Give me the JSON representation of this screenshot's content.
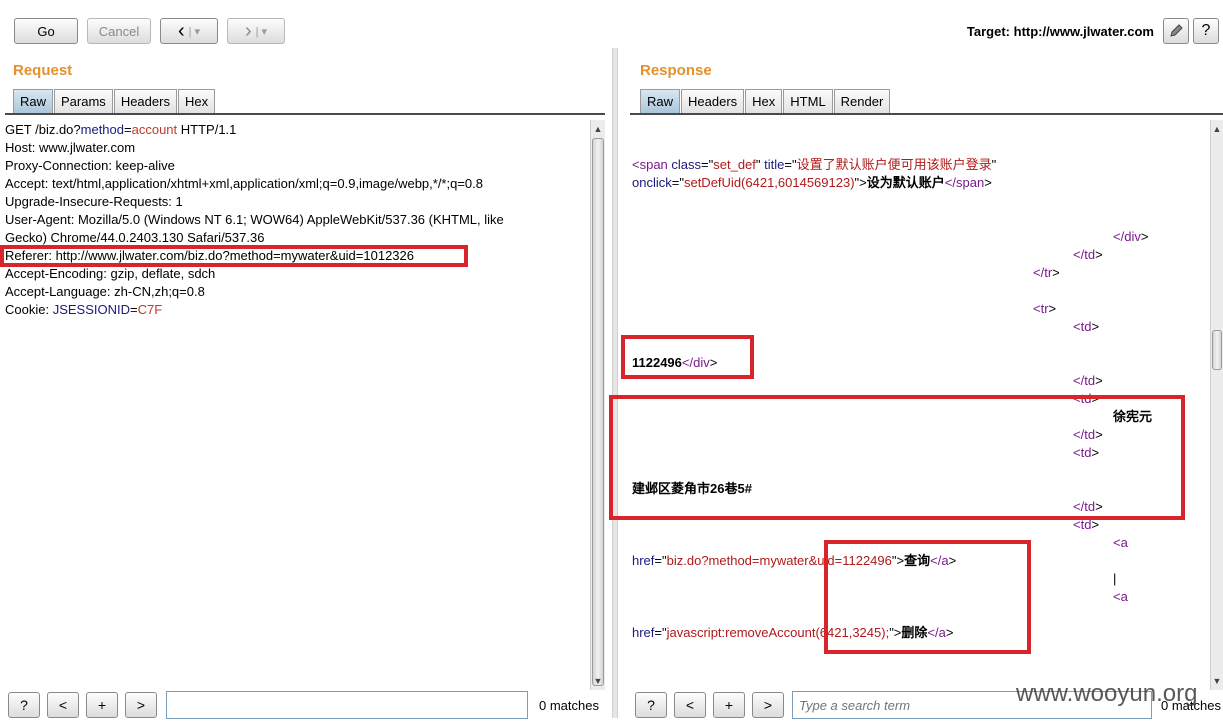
{
  "toolbar": {
    "go_label": "Go",
    "cancel_label": "Cancel",
    "back_icon": "chevron-left-icon",
    "forward_icon": "chevron-right-icon",
    "dropdown_glyph": "▾",
    "target_label": "Target: http://www.jlwater.com",
    "edit_icon": "pencil-icon",
    "help_label": "?"
  },
  "request": {
    "title": "Request",
    "tabs": [
      "Raw",
      "Params",
      "Headers",
      "Hex"
    ],
    "active_tab": "Raw",
    "lines": [
      {
        "parts": [
          {
            "t": "GET /biz.do?",
            "c": ""
          },
          {
            "t": "method",
            "c": "at"
          },
          {
            "t": "=",
            "c": ""
          },
          {
            "t": "account",
            "c": "kw"
          },
          {
            "t": " HTTP/1.1",
            "c": ""
          }
        ]
      },
      {
        "parts": [
          {
            "t": "Host: www.jlwater.com",
            "c": ""
          }
        ]
      },
      {
        "parts": [
          {
            "t": "Proxy-Connection: keep-alive",
            "c": ""
          }
        ]
      },
      {
        "parts": [
          {
            "t": "Accept: text/html,application/xhtml+xml,application/xml;q=0.9,image/webp,*/*;q=0.8",
            "c": ""
          }
        ]
      },
      {
        "parts": [
          {
            "t": "Upgrade-Insecure-Requests: 1",
            "c": ""
          }
        ]
      },
      {
        "parts": [
          {
            "t": "User-Agent: Mozilla/5.0 (Windows NT 6.1; WOW64) AppleWebKit/537.36 (KHTML, like",
            "c": ""
          }
        ]
      },
      {
        "parts": [
          {
            "t": "Gecko) Chrome/44.0.2403.130 Safari/537.36",
            "c": ""
          }
        ]
      },
      {
        "parts": [
          {
            "t": "Referer: http://www.jlwater.com/biz.do?method=mywater&uid=1012326",
            "c": ""
          }
        ]
      },
      {
        "parts": [
          {
            "t": "Accept-Encoding: gzip, deflate, sdch",
            "c": ""
          }
        ]
      },
      {
        "parts": [
          {
            "t": "Accept-Language: zh-CN,zh;q=0.8",
            "c": ""
          }
        ]
      },
      {
        "parts": [
          {
            "t": "Cookie: ",
            "c": ""
          },
          {
            "t": "JSESSIONID",
            "c": "at"
          },
          {
            "t": "=",
            "c": ""
          },
          {
            "t": "C7F",
            "c": "kw"
          }
        ]
      }
    ],
    "search_value": "",
    "matches": "0 matches",
    "help_label": "?",
    "prev_label": "<",
    "add_label": "+",
    "next_label": ">"
  },
  "response": {
    "title": "Response",
    "tabs": [
      "Raw",
      "Headers",
      "Hex",
      "HTML",
      "Render"
    ],
    "active_tab": "Raw",
    "lines": [
      {
        "parts": [
          {
            "t": "<",
            "c": "tg"
          },
          {
            "t": "span",
            "c": "tg"
          },
          {
            "t": " class",
            "c": "at"
          },
          {
            "t": "=\"",
            "c": ""
          },
          {
            "t": "set_def",
            "c": "av"
          },
          {
            "t": "\" ",
            "c": ""
          },
          {
            "t": "title",
            "c": "at"
          },
          {
            "t": "=\"",
            "c": ""
          },
          {
            "t": "设置了默认账户便可用该账户登录",
            "c": "av"
          },
          {
            "t": "\"",
            "c": ""
          }
        ]
      },
      {
        "parts": [
          {
            "t": "onclick",
            "c": "at"
          },
          {
            "t": "=\"",
            "c": ""
          },
          {
            "t": "setDefUid(6421,6014569123)",
            "c": "av"
          },
          {
            "t": "\">",
            "c": ""
          },
          {
            "t": "设为默认账户",
            "c": "bold"
          },
          {
            "t": "</",
            "c": "tg"
          },
          {
            "t": "span",
            "c": "tg"
          },
          {
            "t": ">",
            "c": ""
          }
        ]
      },
      {
        "parts": [
          {
            "t": "</",
            "c": "tg"
          },
          {
            "t": "div",
            "c": "tg"
          },
          {
            "t": ">",
            "c": ""
          }
        ]
      },
      {
        "parts": [
          {
            "t": "</",
            "c": "tg"
          },
          {
            "t": "td",
            "c": "tg"
          },
          {
            "t": ">",
            "c": ""
          }
        ]
      },
      {
        "parts": [
          {
            "t": "</",
            "c": "tg"
          },
          {
            "t": "tr",
            "c": "tg"
          },
          {
            "t": ">",
            "c": ""
          }
        ]
      },
      {
        "parts": [
          {
            "t": "<",
            "c": "tg"
          },
          {
            "t": "tr",
            "c": "tg"
          },
          {
            "t": ">",
            "c": ""
          }
        ]
      },
      {
        "parts": [
          {
            "t": "<",
            "c": "tg"
          },
          {
            "t": "td",
            "c": "tg"
          },
          {
            "t": ">",
            "c": ""
          }
        ]
      },
      {
        "parts": [
          {
            "t": "1122496",
            "c": "bold"
          },
          {
            "t": "</",
            "c": "tg"
          },
          {
            "t": "div",
            "c": "tg"
          },
          {
            "t": ">",
            "c": ""
          }
        ]
      },
      {
        "parts": [
          {
            "t": "</",
            "c": "tg"
          },
          {
            "t": "td",
            "c": "tg"
          },
          {
            "t": ">",
            "c": ""
          }
        ]
      },
      {
        "parts": [
          {
            "t": "<",
            "c": "tg"
          },
          {
            "t": "td",
            "c": "tg"
          },
          {
            "t": ">",
            "c": ""
          }
        ]
      },
      {
        "parts": [
          {
            "t": "徐宪元",
            "c": "bold"
          }
        ]
      },
      {
        "parts": [
          {
            "t": "</",
            "c": "tg"
          },
          {
            "t": "td",
            "c": "tg"
          },
          {
            "t": ">",
            "c": ""
          }
        ]
      },
      {
        "parts": [
          {
            "t": "<",
            "c": "tg"
          },
          {
            "t": "td",
            "c": "tg"
          },
          {
            "t": ">",
            "c": ""
          }
        ]
      },
      {
        "parts": [
          {
            "t": "建邺区菱角市26巷5#",
            "c": "bold"
          }
        ]
      },
      {
        "parts": [
          {
            "t": "</",
            "c": "tg"
          },
          {
            "t": "td",
            "c": "tg"
          },
          {
            "t": ">",
            "c": ""
          }
        ]
      },
      {
        "parts": [
          {
            "t": "<",
            "c": "tg"
          },
          {
            "t": "td",
            "c": "tg"
          },
          {
            "t": ">",
            "c": ""
          }
        ]
      },
      {
        "parts": [
          {
            "t": "<",
            "c": "tg"
          },
          {
            "t": "a",
            "c": "tg"
          }
        ]
      },
      {
        "parts": [
          {
            "t": "href",
            "c": "at"
          },
          {
            "t": "=\"",
            "c": ""
          },
          {
            "t": "biz.do?method=mywater&uid=1122496",
            "c": "av"
          },
          {
            "t": "\">",
            "c": ""
          },
          {
            "t": "查询",
            "c": "bold"
          },
          {
            "t": "</",
            "c": "tg"
          },
          {
            "t": "a",
            "c": "tg"
          },
          {
            "t": ">",
            "c": ""
          }
        ]
      },
      {
        "parts": [
          {
            "t": "|",
            "c": ""
          }
        ]
      },
      {
        "parts": [
          {
            "t": "<",
            "c": "tg"
          },
          {
            "t": "a",
            "c": "tg"
          }
        ]
      },
      {
        "parts": [
          {
            "t": "href",
            "c": "at"
          },
          {
            "t": "=\"",
            "c": ""
          },
          {
            "t": "javascript:removeAccount(6421,3245);",
            "c": "av"
          },
          {
            "t": "\">",
            "c": ""
          },
          {
            "t": "删除",
            "c": "bold"
          },
          {
            "t": "</",
            "c": "tg"
          },
          {
            "t": "a",
            "c": "tg"
          },
          {
            "t": ">",
            "c": ""
          }
        ]
      }
    ],
    "search_placeholder": "Type a search term",
    "matches": "0 matches",
    "help_label": "?",
    "prev_label": "<",
    "add_label": "+",
    "next_label": ">"
  },
  "watermark": "www.wooyun.org",
  "colors": {
    "title": "#e5902b",
    "highlight": "#d8242b",
    "tag": "#7a1a8c",
    "attr": "#1a1a7a",
    "value": "#b01a1a"
  }
}
